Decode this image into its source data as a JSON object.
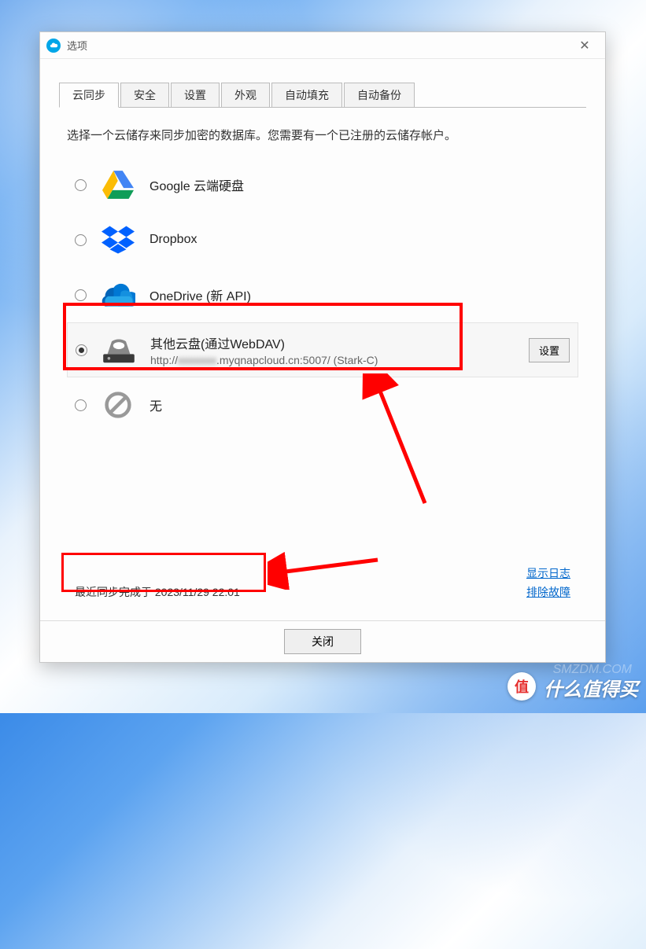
{
  "window": {
    "title": "选项"
  },
  "tabs": [
    {
      "label": "云同步",
      "active": true
    },
    {
      "label": "安全"
    },
    {
      "label": "设置"
    },
    {
      "label": "外观"
    },
    {
      "label": "自动填充"
    },
    {
      "label": "自动备份"
    }
  ],
  "instruction": "选择一个云储存来同步加密的数据库。您需要有一个已注册的云储存帐户。",
  "services": [
    {
      "name": "Google 云端硬盘",
      "icon": "google-drive"
    },
    {
      "name": "Dropbox",
      "icon": "dropbox"
    },
    {
      "name": "OneDrive (新 API)",
      "icon": "onedrive"
    },
    {
      "name": "其他云盘(通过WebDAV)",
      "icon": "webdav",
      "selected": true,
      "sub_prefix": "http://",
      "sub_hidden": "xxxxxxx",
      "sub_suffix": ".myqnapcloud.cn:5007/ (Stark-C)",
      "settings_label": "设置"
    },
    {
      "name": "无",
      "icon": "none"
    }
  ],
  "sync_status": "最近同步完成于 2023/11/29 22:01",
  "links": {
    "show_log": "显示日志",
    "troubleshoot": "排除故障"
  },
  "close_button": "关闭",
  "watermark": {
    "badge": "值",
    "text": "什么值得买",
    "faint": "SMZDM.COM"
  }
}
